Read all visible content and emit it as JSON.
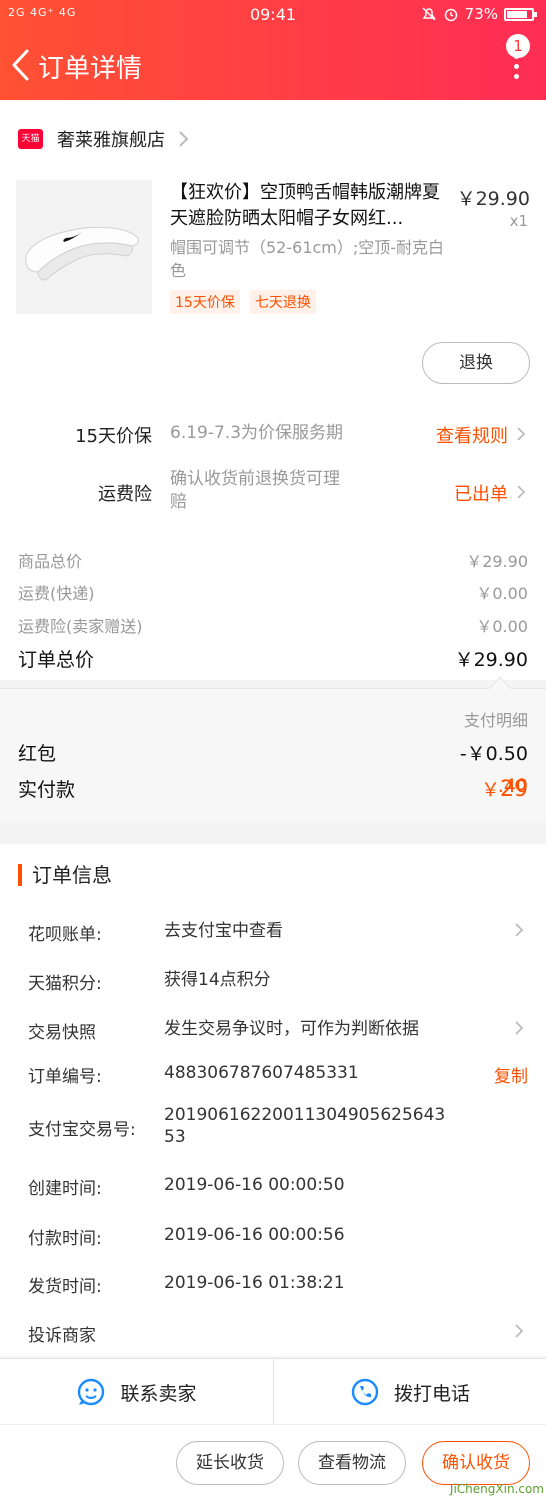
{
  "status_bar": {
    "signal": "2G 4G⁺ 4G",
    "time": "09:41",
    "battery": "73%"
  },
  "header": {
    "title": "订单详情",
    "badge": "1"
  },
  "shop": {
    "icon_text": "天猫",
    "name": "奢莱雅旗舰店"
  },
  "product": {
    "title": "【狂欢价】空顶鸭舌帽韩版潮牌夏天遮脸防晒太阳帽子女网红...",
    "spec": "帽围可调节（52-61cm）;空顶-耐克白色",
    "tags": [
      "15天价保",
      "七天退换"
    ],
    "price": "￥29.90",
    "qty": "x1",
    "return_button": "退换"
  },
  "services": [
    {
      "label": "15天价保",
      "desc": "6.19-7.3为价保服务期",
      "action": "查看规则"
    },
    {
      "label": "运费险",
      "desc": "确认收货前退换货可理赔",
      "action": "已出单"
    }
  ],
  "summary": [
    {
      "k": "商品总价",
      "v": "￥29.90"
    },
    {
      "k": "运费(快递)",
      "v": "￥0.00"
    },
    {
      "k": "运费险(卖家赠送)",
      "v": "￥0.00"
    }
  ],
  "order_total": {
    "k": "订单总价",
    "v": "￥29.90"
  },
  "payment": {
    "detail_link": "支付明细",
    "red_packet": {
      "k": "红包",
      "v": "-￥0.50"
    },
    "actual": {
      "k": "实付款",
      "currency": "￥",
      "int": "29",
      "dec": ".40"
    }
  },
  "order_info": {
    "title": "订单信息",
    "rows": [
      {
        "k": "花呗账单:",
        "v": "去支付宝中查看"
      },
      {
        "k": "天猫积分:",
        "v": "获得14点积分"
      },
      {
        "k": "交易快照",
        "v": "发生交易争议时，可作为判断依据"
      },
      {
        "k": "订单编号:",
        "v": "488306787607485331",
        "action": "复制"
      },
      {
        "k": "支付宝交易号:",
        "v": "20190616220011304905625643 53"
      },
      {
        "k": "创建时间:",
        "v": "2019-06-16 00:00:50"
      },
      {
        "k": "付款时间:",
        "v": "2019-06-16 00:00:56"
      },
      {
        "k": "发货时间:",
        "v": "2019-06-16 01:38:21"
      },
      {
        "k": "投诉商家",
        "v": ""
      }
    ]
  },
  "bottom": {
    "contact": "联系卖家",
    "call": "拨打电话",
    "extend": "延长收货",
    "logistics": "查看物流",
    "confirm": "确认收货"
  },
  "watermark": "JiChengXin.com",
  "colors": {
    "accent": "#ff5000",
    "header_start": "#ff5133",
    "header_end": "#ff2d55",
    "tmall": "#ff0036"
  }
}
